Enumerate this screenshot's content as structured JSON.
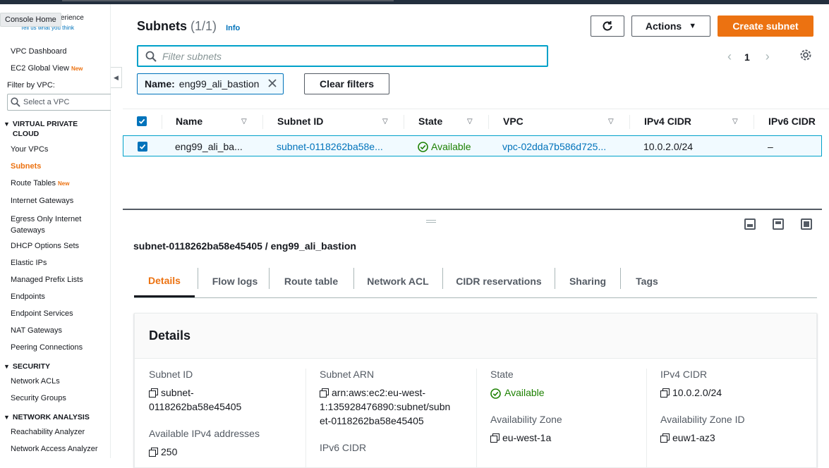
{
  "sidebar": {
    "tooltip": "Console Home",
    "experience_fragment": "erience",
    "tell_us": "Tell us what you think",
    "top_items": [
      {
        "label": "VPC Dashboard",
        "badge": ""
      },
      {
        "label": "EC2 Global View",
        "badge": "New"
      }
    ],
    "filter_label": "Filter by VPC:",
    "vpc_select_placeholder": "Select a VPC",
    "sections": [
      {
        "title": "VIRTUAL PRIVATE CLOUD",
        "items": [
          "Your VPCs",
          "Subnets",
          "Route Tables",
          "Internet Gateways",
          "Egress Only Internet Gateways",
          "DHCP Options Sets",
          "Elastic IPs",
          "Managed Prefix Lists",
          "Endpoints",
          "Endpoint Services",
          "NAT Gateways",
          "Peering Connections"
        ]
      },
      {
        "title": "SECURITY",
        "items": [
          "Network ACLs",
          "Security Groups"
        ]
      },
      {
        "title": "NETWORK ANALYSIS",
        "items": [
          "Reachability Analyzer",
          "Network Access Analyzer"
        ]
      }
    ],
    "vpc_section_title_line1": "VIRTUAL PRIVATE",
    "vpc_section_title_line2": "CLOUD",
    "route_tables_badge": "New",
    "egress_line1": "Egress Only Internet",
    "egress_line2": "Gateways",
    "active_item": "Subnets"
  },
  "header": {
    "title": "Subnets",
    "count": "(1/1)",
    "info": "Info",
    "actions_label": "Actions",
    "create_label": "Create subnet"
  },
  "search": {
    "placeholder": "Filter subnets"
  },
  "pagination": {
    "page": "1"
  },
  "filter_token": {
    "key": "Name:",
    "value": "eng99_ali_bastion"
  },
  "clear_filters": "Clear filters",
  "table": {
    "columns": [
      "Name",
      "Subnet ID",
      "State",
      "VPC",
      "IPv4 CIDR",
      "IPv6 CIDR"
    ],
    "rows": [
      {
        "name": "eng99_ali_ba...",
        "subnet_id": "subnet-0118262ba58e...",
        "state": "Available",
        "vpc": "vpc-02dda7b586d725...",
        "ipv4": "10.0.2.0/24",
        "ipv6": "–"
      }
    ]
  },
  "detail": {
    "title": "subnet-0118262ba58e45405 / eng99_ali_bastion",
    "tabs": [
      "Details",
      "Flow logs",
      "Route table",
      "Network ACL",
      "CIDR reservations",
      "Sharing",
      "Tags"
    ],
    "active_tab": "Details",
    "card_title": "Details",
    "fields": {
      "subnet_id_label": "Subnet ID",
      "subnet_id_value_1": "subnet-",
      "subnet_id_value_2": "0118262ba58e45405",
      "avail_ipv4_label": "Available IPv4 addresses",
      "avail_ipv4_value": "250",
      "arn_label": "Subnet ARN",
      "arn_value_1": "arn:aws:ec2:eu-west-",
      "arn_value_2": "1:135928476890:subnet/subn",
      "arn_value_3": "et-0118262ba58e45405",
      "ipv6_label": "IPv6 CIDR",
      "state_label": "State",
      "state_value": "Available",
      "az_label": "Availability Zone",
      "az_value": "eu-west-1a",
      "ipv4_label": "IPv4 CIDR",
      "ipv4_value": "10.0.2.0/24",
      "azid_label": "Availability Zone ID",
      "azid_value": "euw1-az3"
    }
  },
  "colors": {
    "accent": "#ec7211",
    "link": "#0073bb",
    "success": "#1d8102",
    "selected_bg": "#f1faff"
  }
}
